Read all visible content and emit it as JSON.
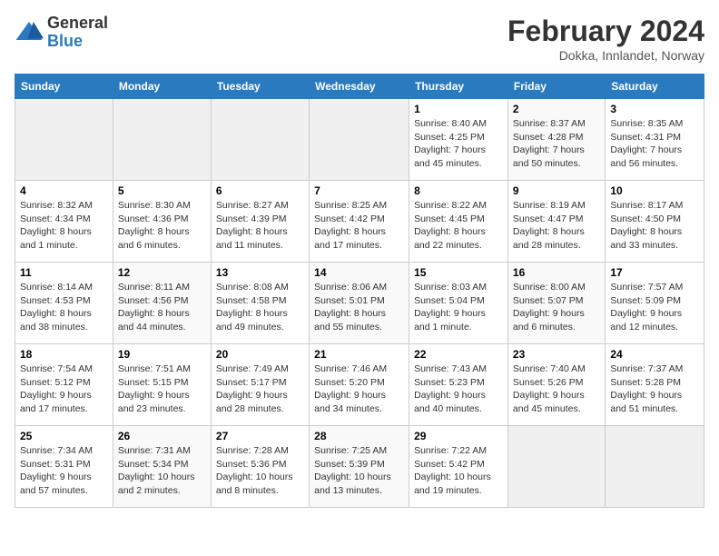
{
  "logo": {
    "general": "General",
    "blue": "Blue"
  },
  "title": "February 2024",
  "location": "Dokka, Innlandet, Norway",
  "weekdays": [
    "Sunday",
    "Monday",
    "Tuesday",
    "Wednesday",
    "Thursday",
    "Friday",
    "Saturday"
  ],
  "weeks": [
    [
      {
        "day": "",
        "info": ""
      },
      {
        "day": "",
        "info": ""
      },
      {
        "day": "",
        "info": ""
      },
      {
        "day": "",
        "info": ""
      },
      {
        "day": "1",
        "info": "Sunrise: 8:40 AM\nSunset: 4:25 PM\nDaylight: 7 hours\nand 45 minutes."
      },
      {
        "day": "2",
        "info": "Sunrise: 8:37 AM\nSunset: 4:28 PM\nDaylight: 7 hours\nand 50 minutes."
      },
      {
        "day": "3",
        "info": "Sunrise: 8:35 AM\nSunset: 4:31 PM\nDaylight: 7 hours\nand 56 minutes."
      }
    ],
    [
      {
        "day": "4",
        "info": "Sunrise: 8:32 AM\nSunset: 4:34 PM\nDaylight: 8 hours\nand 1 minute."
      },
      {
        "day": "5",
        "info": "Sunrise: 8:30 AM\nSunset: 4:36 PM\nDaylight: 8 hours\nand 6 minutes."
      },
      {
        "day": "6",
        "info": "Sunrise: 8:27 AM\nSunset: 4:39 PM\nDaylight: 8 hours\nand 11 minutes."
      },
      {
        "day": "7",
        "info": "Sunrise: 8:25 AM\nSunset: 4:42 PM\nDaylight: 8 hours\nand 17 minutes."
      },
      {
        "day": "8",
        "info": "Sunrise: 8:22 AM\nSunset: 4:45 PM\nDaylight: 8 hours\nand 22 minutes."
      },
      {
        "day": "9",
        "info": "Sunrise: 8:19 AM\nSunset: 4:47 PM\nDaylight: 8 hours\nand 28 minutes."
      },
      {
        "day": "10",
        "info": "Sunrise: 8:17 AM\nSunset: 4:50 PM\nDaylight: 8 hours\nand 33 minutes."
      }
    ],
    [
      {
        "day": "11",
        "info": "Sunrise: 8:14 AM\nSunset: 4:53 PM\nDaylight: 8 hours\nand 38 minutes."
      },
      {
        "day": "12",
        "info": "Sunrise: 8:11 AM\nSunset: 4:56 PM\nDaylight: 8 hours\nand 44 minutes."
      },
      {
        "day": "13",
        "info": "Sunrise: 8:08 AM\nSunset: 4:58 PM\nDaylight: 8 hours\nand 49 minutes."
      },
      {
        "day": "14",
        "info": "Sunrise: 8:06 AM\nSunset: 5:01 PM\nDaylight: 8 hours\nand 55 minutes."
      },
      {
        "day": "15",
        "info": "Sunrise: 8:03 AM\nSunset: 5:04 PM\nDaylight: 9 hours\nand 1 minute."
      },
      {
        "day": "16",
        "info": "Sunrise: 8:00 AM\nSunset: 5:07 PM\nDaylight: 9 hours\nand 6 minutes."
      },
      {
        "day": "17",
        "info": "Sunrise: 7:57 AM\nSunset: 5:09 PM\nDaylight: 9 hours\nand 12 minutes."
      }
    ],
    [
      {
        "day": "18",
        "info": "Sunrise: 7:54 AM\nSunset: 5:12 PM\nDaylight: 9 hours\nand 17 minutes."
      },
      {
        "day": "19",
        "info": "Sunrise: 7:51 AM\nSunset: 5:15 PM\nDaylight: 9 hours\nand 23 minutes."
      },
      {
        "day": "20",
        "info": "Sunrise: 7:49 AM\nSunset: 5:17 PM\nDaylight: 9 hours\nand 28 minutes."
      },
      {
        "day": "21",
        "info": "Sunrise: 7:46 AM\nSunset: 5:20 PM\nDaylight: 9 hours\nand 34 minutes."
      },
      {
        "day": "22",
        "info": "Sunrise: 7:43 AM\nSunset: 5:23 PM\nDaylight: 9 hours\nand 40 minutes."
      },
      {
        "day": "23",
        "info": "Sunrise: 7:40 AM\nSunset: 5:26 PM\nDaylight: 9 hours\nand 45 minutes."
      },
      {
        "day": "24",
        "info": "Sunrise: 7:37 AM\nSunset: 5:28 PM\nDaylight: 9 hours\nand 51 minutes."
      }
    ],
    [
      {
        "day": "25",
        "info": "Sunrise: 7:34 AM\nSunset: 5:31 PM\nDaylight: 9 hours\nand 57 minutes."
      },
      {
        "day": "26",
        "info": "Sunrise: 7:31 AM\nSunset: 5:34 PM\nDaylight: 10 hours\nand 2 minutes."
      },
      {
        "day": "27",
        "info": "Sunrise: 7:28 AM\nSunset: 5:36 PM\nDaylight: 10 hours\nand 8 minutes."
      },
      {
        "day": "28",
        "info": "Sunrise: 7:25 AM\nSunset: 5:39 PM\nDaylight: 10 hours\nand 13 minutes."
      },
      {
        "day": "29",
        "info": "Sunrise: 7:22 AM\nSunset: 5:42 PM\nDaylight: 10 hours\nand 19 minutes."
      },
      {
        "day": "",
        "info": ""
      },
      {
        "day": "",
        "info": ""
      }
    ]
  ]
}
